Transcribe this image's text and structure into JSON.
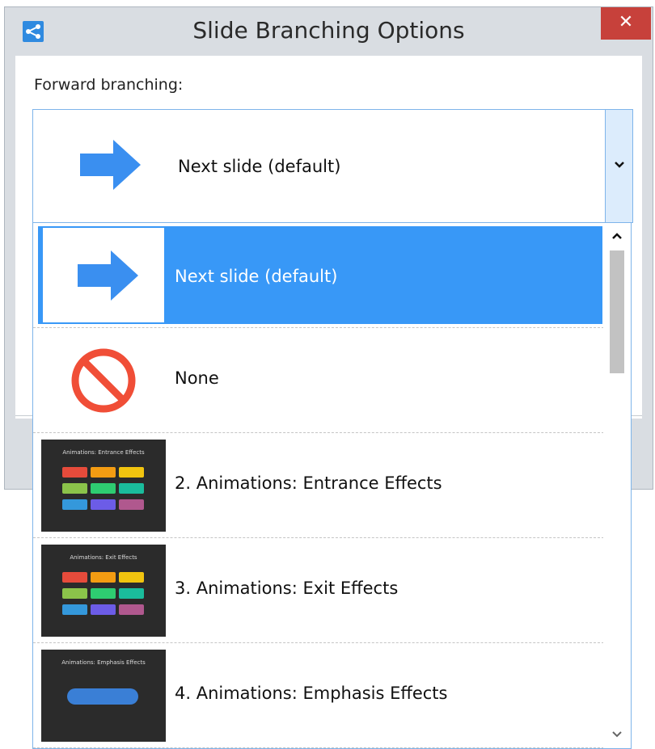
{
  "dialog": {
    "title": "Slide Branching Options",
    "close_label": "✕",
    "app_icon": "branching-icon"
  },
  "field": {
    "label": "Forward branching:"
  },
  "combo": {
    "selected_value": "Next slide (default)",
    "selected_icon": "arrow-right-icon",
    "dropdown_icon": "chevron-down-icon"
  },
  "options": [
    {
      "label": "Next slide (default)",
      "icon": "arrow-right-icon",
      "selected": true
    },
    {
      "label": "None",
      "icon": "no-symbol-icon",
      "selected": false
    },
    {
      "label": "2. Animations: Entrance Effects",
      "thumb_title": "Animations: Entrance Effects",
      "selected": false
    },
    {
      "label": "3. Animations: Exit Effects",
      "thumb_title": "Animations: Exit Effects",
      "selected": false
    },
    {
      "label": "4. Animations: Emphasis Effects",
      "thumb_title": "Animations: Emphasis Effects",
      "selected": false
    }
  ],
  "colors": {
    "selection": "#3898f7",
    "arrow": "#3a8ff0",
    "no_symbol": "#f04e37",
    "close_button": "#c7413b"
  }
}
